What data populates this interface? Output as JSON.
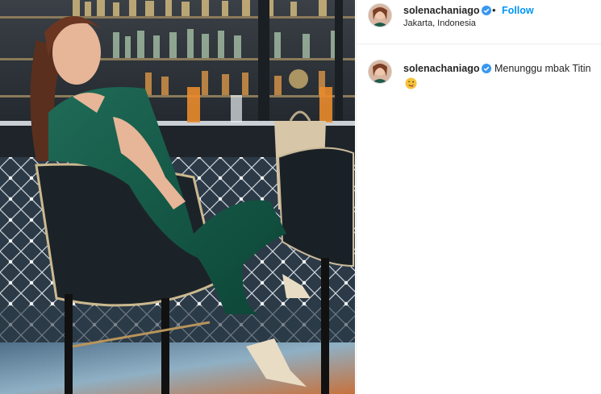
{
  "post": {
    "username": "solenachaniago",
    "verified": true,
    "follow_label": "Follow",
    "separator": "•",
    "location": "Jakarta, Indonesia",
    "more_label": "•••",
    "image_description_icon": "photo"
  },
  "caption": {
    "username": "solenachaniago",
    "verified": true,
    "text": "Menunggu mbak Titin",
    "emoji": "wink-tongue-emoji"
  },
  "colors": {
    "accent": "#0095f6",
    "verified_badge": "#3897f0",
    "text": "#262626"
  }
}
